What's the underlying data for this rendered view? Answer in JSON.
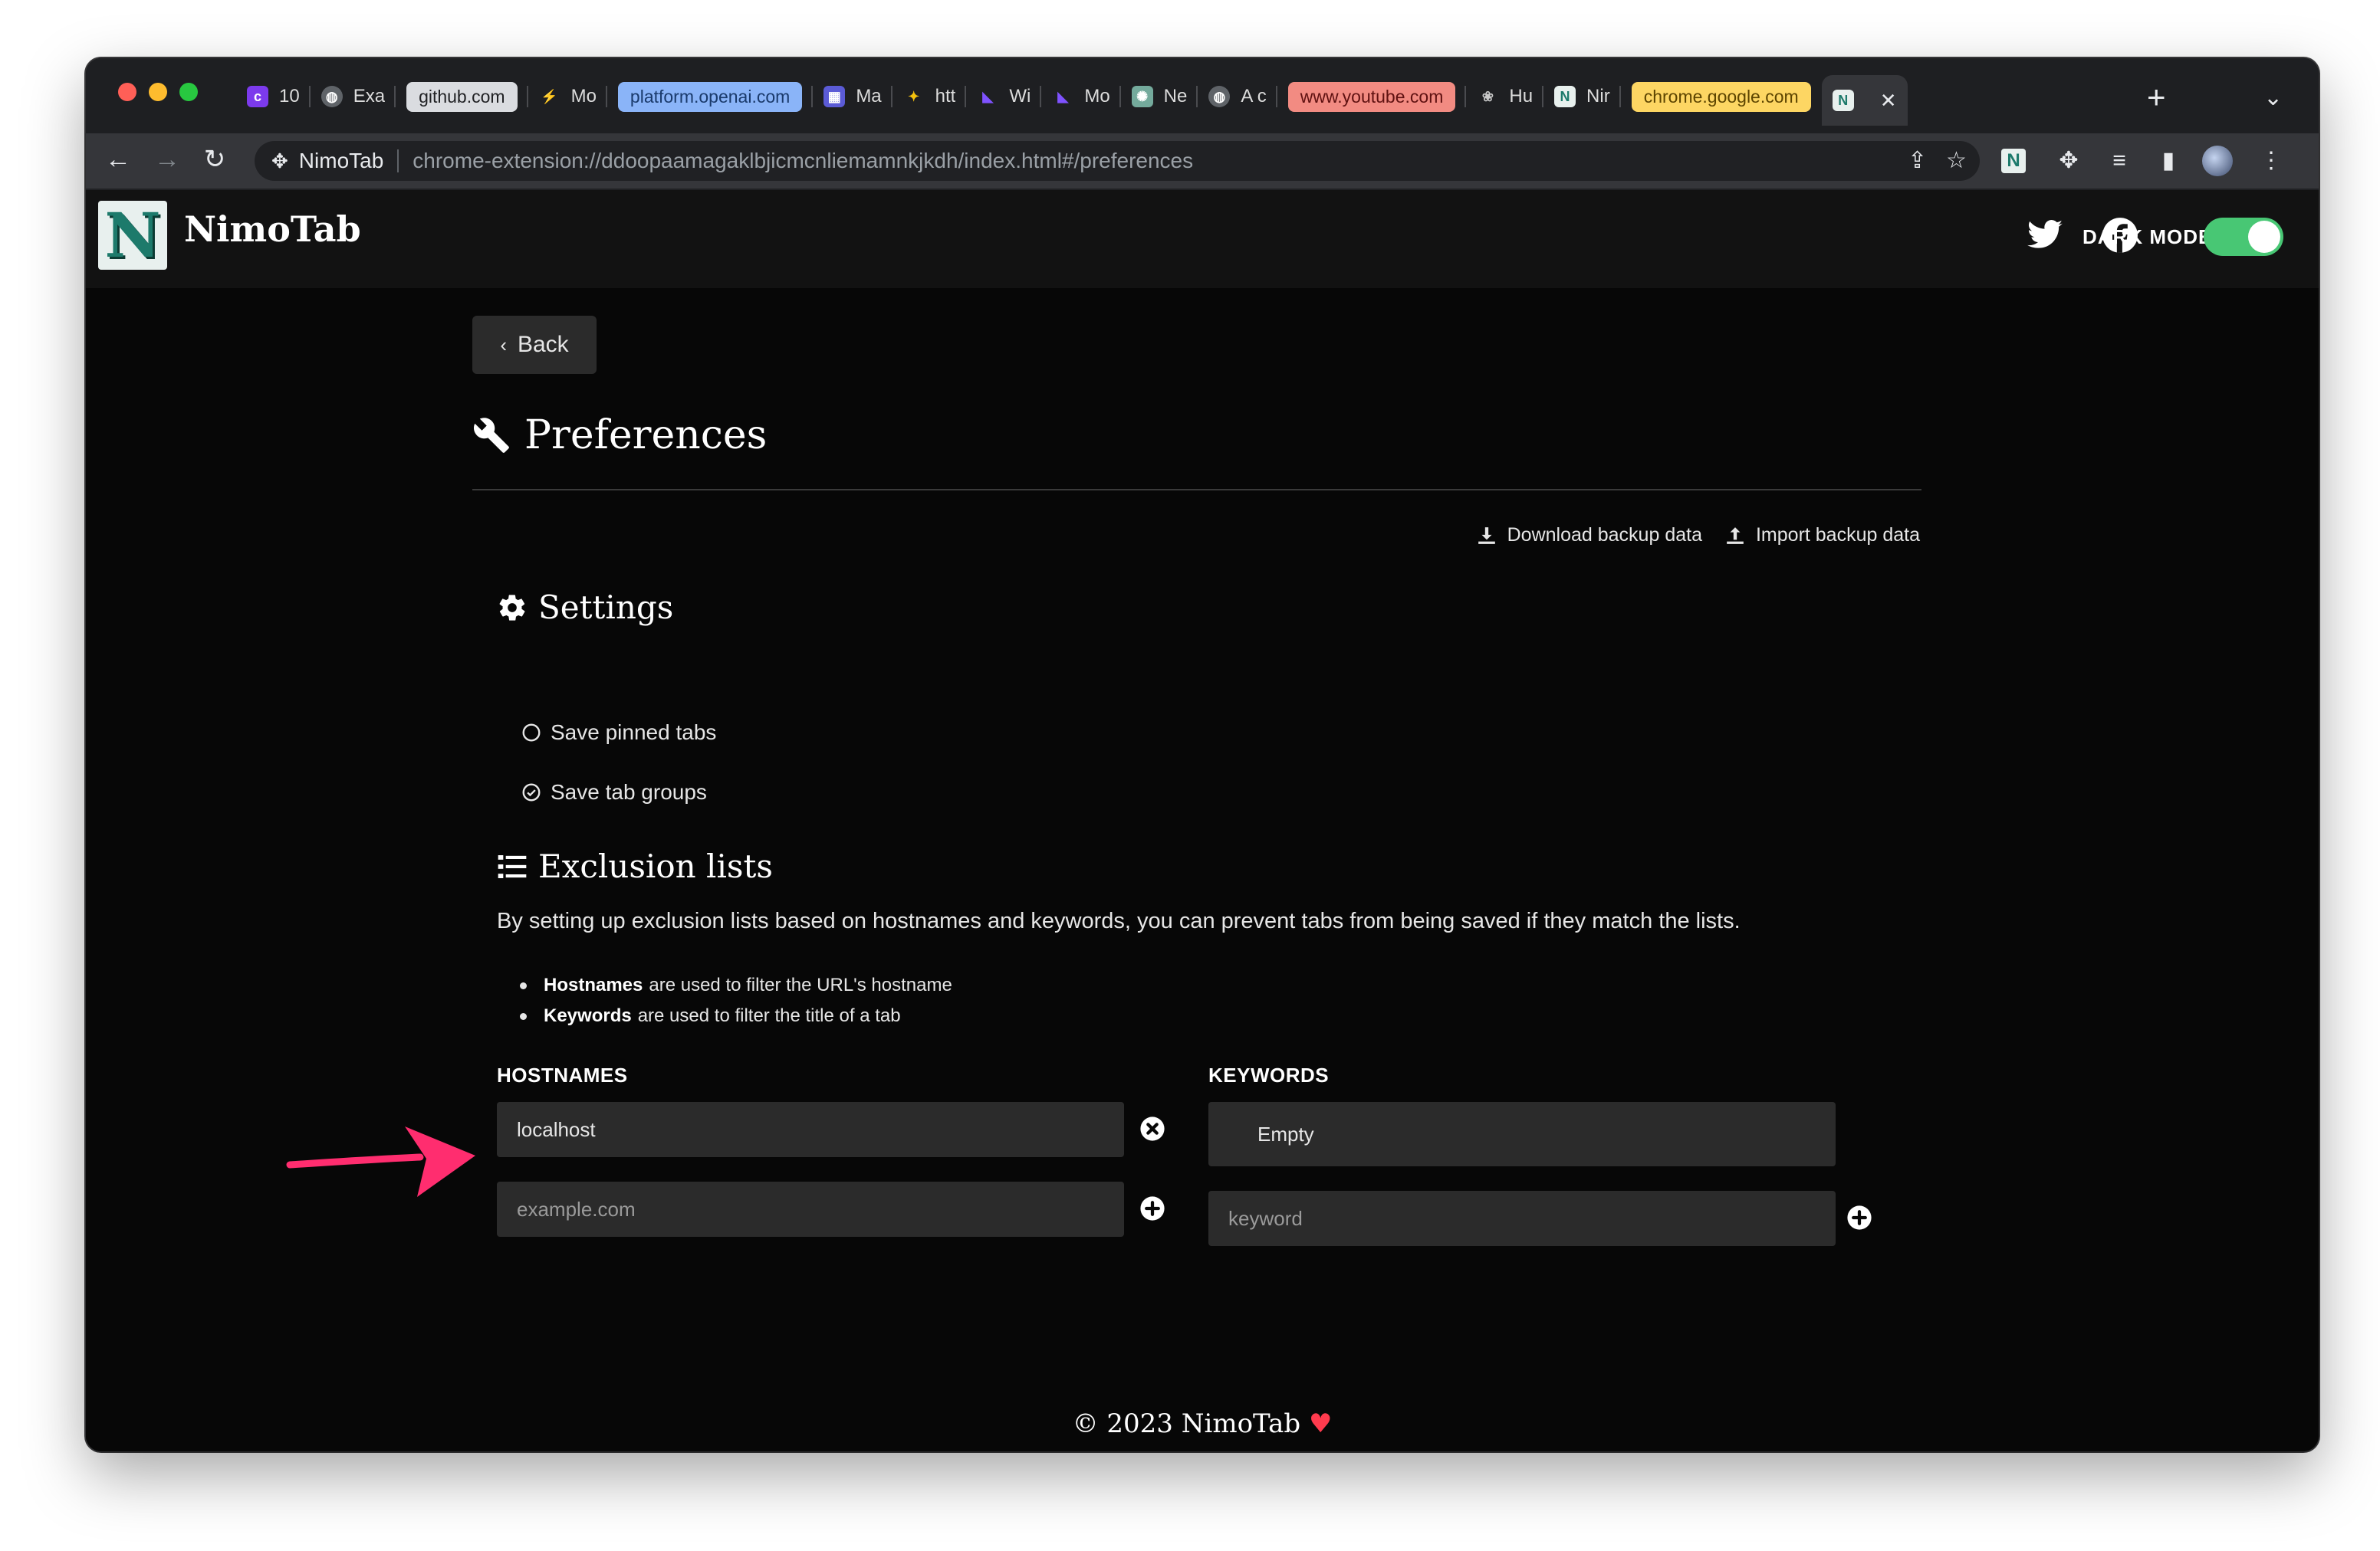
{
  "browser": {
    "tabs": [
      {
        "label": "10",
        "favicon": "circle-c-icon",
        "fav_color": "#7c3aed"
      },
      {
        "label": "Exa",
        "favicon": "globe-icon",
        "fav_color": "#3a3b3f"
      },
      {
        "label": "github.com",
        "chip": true,
        "chip_bg": "#dadce0",
        "chip_fg": "#202124"
      },
      {
        "label": "Mo",
        "favicon": "bolt-icon",
        "fav_color": "#f4b400"
      },
      {
        "label": "platform.openai.com",
        "chip": true,
        "chip_bg": "#8ab4f8",
        "chip_fg": "#1a3a6b"
      },
      {
        "label": "Ma",
        "favicon": "grid-icon",
        "fav_color": "#5b5bd6"
      },
      {
        "label": "htt",
        "favicon": "sparkle-icon",
        "fav_color": "#f4c20d"
      },
      {
        "label": "Wi",
        "favicon": "kotlin-icon",
        "fav_color": "#7f52ff"
      },
      {
        "label": "Mo",
        "favicon": "kotlin-icon",
        "fav_color": "#7f52ff"
      },
      {
        "label": "Ne",
        "favicon": "openai-icon",
        "fav_color": "#74aa9c"
      },
      {
        "label": "A c",
        "favicon": "globe-icon",
        "fav_color": "#3a3b3f"
      },
      {
        "label": "www.youtube.com",
        "chip": true,
        "chip_bg": "#f28b82",
        "chip_fg": "#5f1111"
      },
      {
        "label": "Hu",
        "favicon": "flower-icon",
        "fav_color": "#3a3b3f"
      },
      {
        "label": "Nir",
        "favicon": "nimotab-icon",
        "fav_color": "#1d7a6b"
      },
      {
        "label": "chrome.google.com",
        "chip": true,
        "chip_bg": "#fdd663",
        "chip_fg": "#5c4400"
      }
    ],
    "active_tab_close": "✕",
    "new_tab": "+",
    "omnibox_site": "NimoTab",
    "omnibox_url": "chrome-extension://ddoopaamagaklbjicmcnliemamnkjkdh/index.html#/preferences"
  },
  "app": {
    "logo_letter": "N",
    "name": "NimoTab",
    "dark_mode_label": "DARK MODE",
    "dark_mode_on": true,
    "accent": "#48c774"
  },
  "page": {
    "back_label": "Back",
    "title": "Preferences",
    "download_backup": "Download backup data",
    "import_backup": "Import backup data",
    "settings_title": "Settings",
    "settings": [
      {
        "label": "Save pinned tabs",
        "checked": false
      },
      {
        "label": "Save tab groups",
        "checked": true
      }
    ],
    "exclusion_title": "Exclusion lists",
    "exclusion_desc": "By setting up exclusion lists based on hostnames and keywords, you can prevent tabs from being saved if they match the lists.",
    "bullets": [
      {
        "bold": "Hostnames",
        "rest": "are used to filter the URL's hostname"
      },
      {
        "bold": "Keywords",
        "rest": "are used to filter the title of a tab"
      }
    ],
    "hostnames_label": "HOSTNAMES",
    "hostnames": [
      "localhost"
    ],
    "hostname_placeholder": "example.com",
    "keywords_label": "KEYWORDS",
    "keywords_empty": "Empty",
    "keyword_placeholder": "keyword",
    "footer": "© 2023 NimoTab",
    "annotation_arrow_color": "#ff2d6f"
  }
}
